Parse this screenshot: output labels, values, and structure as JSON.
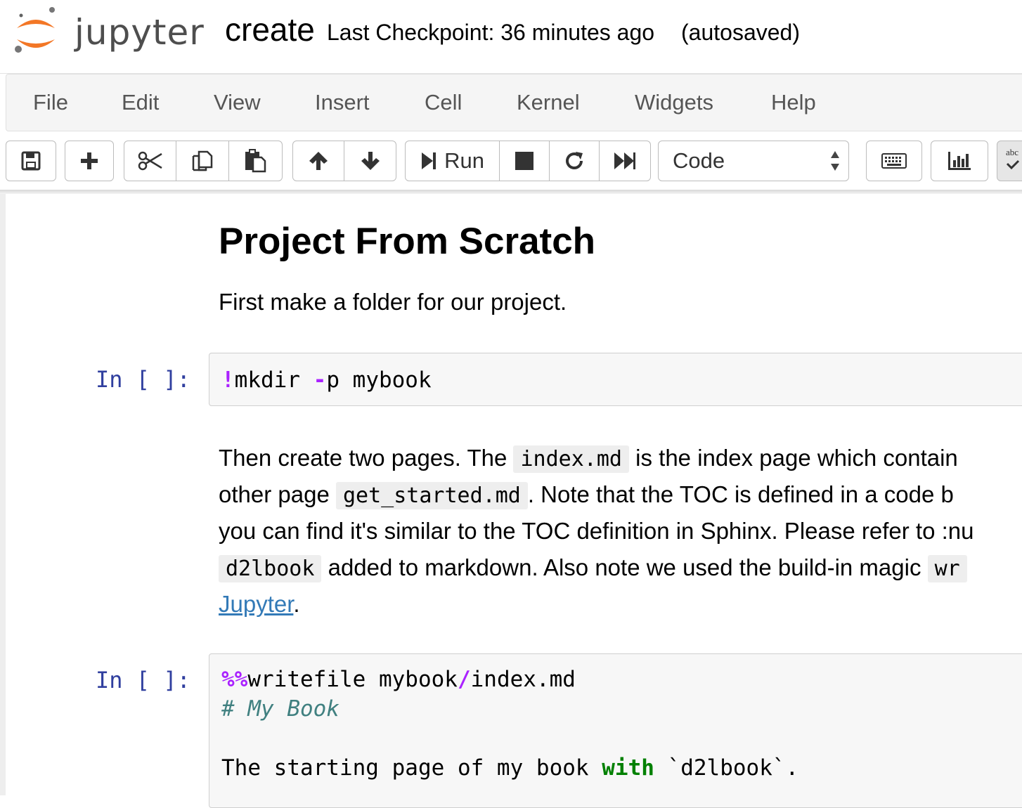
{
  "header": {
    "logo_text": "jupyter",
    "notebook_name": "create",
    "checkpoint": "Last Checkpoint: 36 minutes ago",
    "autosave": "(autosaved)"
  },
  "menu": {
    "items": [
      "File",
      "Edit",
      "View",
      "Insert",
      "Cell",
      "Kernel",
      "Widgets",
      "Help"
    ]
  },
  "toolbar": {
    "run_label": "Run",
    "cell_type": "Code",
    "abc_label": "abc"
  },
  "icons": {
    "save": "save-icon",
    "add": "plus-icon",
    "cut": "scissors-icon",
    "copy": "copy-icon",
    "paste": "paste-icon",
    "up": "arrow-up-icon",
    "down": "arrow-down-icon",
    "run": "step-forward-icon",
    "stop": "stop-icon",
    "restart": "restart-icon",
    "run_all": "fast-forward-icon",
    "keyboard": "keyboard-icon",
    "chart": "bar-chart-icon"
  },
  "colors": {
    "prompt": "#303f9f",
    "magic": "#aa22ff",
    "keyword": "#008000",
    "comment": "#408080",
    "link": "#337ab7",
    "logo_orange": "#f37726"
  },
  "cells": {
    "md1": {
      "title": "Project From Scratch",
      "text": "First make a folder for our project."
    },
    "code1": {
      "prompt": "In [ ]:",
      "bang": "!",
      "cmd": "mkdir ",
      "flag": "-",
      "rest": "p mybook"
    },
    "md2": {
      "l1_a": "Then create two pages. The ",
      "l1_code": "index.md",
      "l1_b": " is the index page which contain",
      "l2_a": "other page ",
      "l2_code": "get_started.md",
      "l2_b": ". Note that the TOC is defined in a code b",
      "l3": "you can find it's similar to the TOC definition in Sphinx. Please refer to :nu",
      "l4_code": "d2lbook",
      "l4_b": " added to markdown. Also note we used the build-in magic ",
      "l4_code2": "wr",
      "l5_link": "Jupyter",
      "l5_b": "."
    },
    "code2": {
      "prompt": "In [ ]:",
      "l1_magic": "%%",
      "l1_a": "writefile mybook",
      "l1_slash": "/",
      "l1_b": "index.md",
      "l2": "# My Book",
      "l4_a": "The starting page of my book ",
      "l4_kw": "with",
      "l4_b": " `d2lbook`."
    }
  }
}
